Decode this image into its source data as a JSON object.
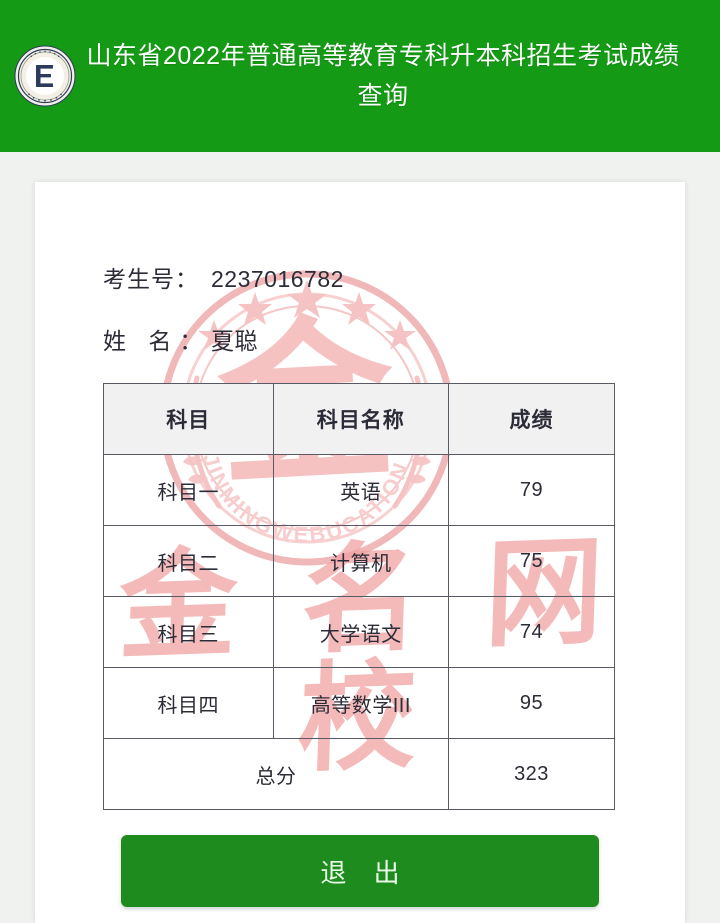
{
  "header": {
    "logo_icon": "shandong-education-seal-icon",
    "title": "山东省2022年普通高等教育专科升本科招生考试成绩查询",
    "background_color": "#149a14",
    "title_color": "#ffffff"
  },
  "watermark": {
    "seal_icon": "jinming-circular-seal-watermark",
    "seal_center_character": "金",
    "seal_arc_text": "JINMINGWEBUCATION",
    "script_text": "金 名 网 校",
    "color": "#f0a0a0"
  },
  "candidate": {
    "exam_number_label": "考生号：",
    "exam_number_value": "2237016782",
    "name_label": "姓 名：",
    "name_value": "夏聪"
  },
  "score_table": {
    "columns": [
      "科目",
      "科目名称",
      "成绩"
    ],
    "rows": [
      {
        "subject": "科目一",
        "name": "英语",
        "score": "79"
      },
      {
        "subject": "科目二",
        "name": "计算机",
        "score": "75"
      },
      {
        "subject": "科目三",
        "name": "大学语文",
        "score": "74"
      },
      {
        "subject": "科目四",
        "name": "高等数学III",
        "score": "95"
      }
    ],
    "total_label": "总分",
    "total_value": "323",
    "header_background": "#f1f1f1",
    "border_color": "#5a5a66"
  },
  "actions": {
    "exit_label": "退 出",
    "exit_background": "#1d8b1d"
  },
  "page": {
    "background_color": "#f0f2f0",
    "card_background": "#ffffff"
  }
}
